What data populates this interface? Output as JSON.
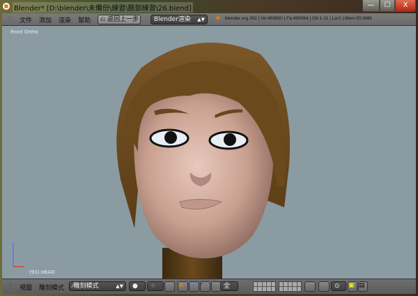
{
  "window": {
    "title": "Blender* [D:\\blender\\未備份\\練習\\臉部練習\\26.blend]",
    "minimize": "—",
    "maximize": "☐",
    "close": "X"
  },
  "topbar": {
    "menus": [
      "文件",
      "添加",
      "渲染",
      "幫助"
    ],
    "undo_label": "返回上一步",
    "render_engine": "Blender渲染",
    "info": "blender.org 262 | Ve:493650 | Fa:490064 | Ob:1-11 | La:0 | Mem:55.86M"
  },
  "viewport": {
    "view_label": "Front Ortho",
    "object_label": "(93) HEAD",
    "background": "#8a9ba2"
  },
  "bottombar": {
    "menus": [
      "視圖",
      "雕刻模式"
    ],
    "mode": "雕刻模式",
    "pivot": "全"
  },
  "colors": {
    "hair": "#6b4a1c",
    "skin": "#d9b2a4",
    "accent": "#e87d0d"
  }
}
